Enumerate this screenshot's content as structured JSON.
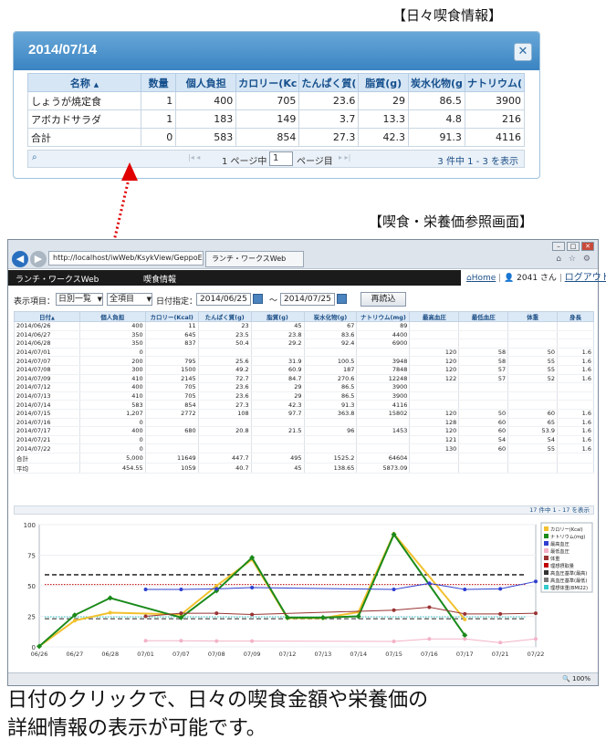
{
  "popup_caption": "【日々喫食情報】",
  "popup": {
    "title": "2014/07/14",
    "close_icon": "close-icon",
    "columns": [
      "名称",
      "数量",
      "個人負担",
      "カロリー(Kc",
      "たんぱく質(",
      "脂質(g)",
      "炭水化物(g",
      "ナトリウム("
    ],
    "sort_mark": "▲",
    "rows": [
      [
        "しょうが焼定食",
        "1",
        "400",
        "705",
        "23.6",
        "29",
        "86.5",
        "3900"
      ],
      [
        "アボカドサラダ",
        "1",
        "183",
        "149",
        "3.7",
        "13.3",
        "4.8",
        "216"
      ],
      [
        "合計",
        "0",
        "583",
        "854",
        "27.3",
        "42.3",
        "91.3",
        "4116"
      ]
    ],
    "pager": {
      "page_label": "1 ページ中",
      "page": "1",
      "page_suffix": "ページ目",
      "count": "3 件中 1 - 3 を表示"
    }
  },
  "main_caption": "【喫食・栄養価参照画面】",
  "browser": {
    "address": "http://localhost/iwWeb/KsykView/GeppoE",
    "tab": "ランチ・ワークスWeb",
    "app_title": "ランチ・ワークスWeb",
    "page_title": "喫食情報",
    "home": "Home",
    "user": "2041 さん",
    "logout": "ログアウト",
    "toolbar": {
      "label1": "表示項目：",
      "mode": "日別一覧",
      "items": "全項目",
      "date_label": "日付指定：",
      "date_from": "2014/06/25",
      "tilde": "～",
      "date_to": "2014/07/25",
      "reload": "再読込"
    },
    "grid_columns": [
      "日付",
      "個人負担",
      "カロリー(Kcal)",
      "たんぱく質(g)",
      "脂質(g)",
      "炭水化物(g)",
      "ナトリウム(mg)",
      "最高血圧",
      "最低血圧",
      "体重",
      "身長"
    ],
    "grid_sort": "▲",
    "grid_rows": [
      [
        "2014/06/26",
        "400",
        "11",
        "23",
        "45",
        "67",
        "89",
        "",
        "",
        "",
        ""
      ],
      [
        "2014/06/27",
        "350",
        "645",
        "23.5",
        "23.8",
        "83.6",
        "4400",
        "",
        "",
        "",
        ""
      ],
      [
        "2014/06/28",
        "350",
        "837",
        "50.4",
        "29.2",
        "92.4",
        "6900",
        "",
        "",
        "",
        ""
      ],
      [
        "2014/07/01",
        "0",
        "",
        "",
        "",
        "",
        "",
        "120",
        "58",
        "50",
        "1.6"
      ],
      [
        "2014/07/07",
        "200",
        "795",
        "25.6",
        "31.9",
        "100.5",
        "3948",
        "120",
        "58",
        "55",
        "1.6"
      ],
      [
        "2014/07/08",
        "300",
        "1500",
        "49.2",
        "60.9",
        "187",
        "7848",
        "120",
        "57",
        "55",
        "1.6"
      ],
      [
        "2014/07/09",
        "410",
        "2145",
        "72.7",
        "84.7",
        "270.6",
        "12248",
        "122",
        "57",
        "52",
        "1.6"
      ],
      [
        "2014/07/12",
        "400",
        "705",
        "23.6",
        "29",
        "86.5",
        "3900",
        "",
        "",
        "",
        ""
      ],
      [
        "2014/07/13",
        "410",
        "705",
        "23.6",
        "29",
        "86.5",
        "3900",
        "",
        "",
        "",
        ""
      ],
      [
        "2014/07/14",
        "583",
        "854",
        "27.3",
        "42.3",
        "91.3",
        "4116",
        "",
        "",
        "",
        ""
      ],
      [
        "2014/07/15",
        "1,207",
        "2772",
        "108",
        "97.7",
        "363.8",
        "15802",
        "120",
        "50",
        "60",
        "1.6"
      ],
      [
        "2014/07/16",
        "0",
        "",
        "",
        "",
        "",
        "",
        "128",
        "60",
        "65",
        "1.6"
      ],
      [
        "2014/07/17",
        "400",
        "680",
        "20.8",
        "21.5",
        "96",
        "1453",
        "120",
        "60",
        "53.9",
        "1.6"
      ],
      [
        "2014/07/21",
        "0",
        "",
        "",
        "",
        "",
        "",
        "121",
        "54",
        "54",
        "1.6"
      ],
      [
        "2014/07/22",
        "0",
        "",
        "",
        "",
        "",
        "",
        "130",
        "60",
        "55",
        "1.6"
      ],
      [
        "合計",
        "5,000",
        "11649",
        "447.7",
        "495",
        "1525.2",
        "64604",
        "",
        "",
        "",
        ""
      ],
      [
        "平均",
        "454.55",
        "1059",
        "40.7",
        "45",
        "138.65",
        "5873.09",
        "",
        "",
        "",
        ""
      ]
    ],
    "grid_pager": "17 件中 1 - 17 を表示",
    "zoom": "100%"
  },
  "chart_data": {
    "type": "line",
    "categories": [
      "06/26",
      "06/27",
      "06/28",
      "07/01",
      "07/07",
      "07/08",
      "07/09",
      "07/12",
      "07/13",
      "07/14",
      "07/15",
      "07/16",
      "07/17",
      "07/21",
      "07/22"
    ],
    "ylim": [
      0,
      100
    ],
    "yticks": [
      "0",
      "25",
      "50",
      "75",
      "100"
    ],
    "legend_placement": "right",
    "series": [
      {
        "name": "カロリー(Kcal)",
        "color": "#f2c12e",
        "values": [
          0.5,
          21.5,
          28,
          null,
          26.5,
          50,
          71.5,
          23.5,
          23.5,
          28.5,
          92.5,
          null,
          22.5,
          null,
          null
        ]
      },
      {
        "name": "ナトリウム(mg)",
        "color": "#1a8a1a",
        "values": [
          0.5,
          26,
          40,
          null,
          24,
          46,
          73,
          24,
          24,
          25,
          92,
          null,
          9.5,
          null,
          null
        ]
      },
      {
        "name": "最高血圧",
        "color": "#2f3fd0",
        "values": [
          null,
          null,
          null,
          47,
          47,
          47.5,
          48.5,
          null,
          null,
          null,
          47,
          52,
          47,
          47.5,
          53.5
        ]
      },
      {
        "name": "最低血圧",
        "color": "#f3b2c8",
        "values": [
          null,
          null,
          null,
          5,
          5,
          4.8,
          4.8,
          null,
          null,
          null,
          4.5,
          6.5,
          6.5,
          3.5,
          6.5
        ]
      },
      {
        "name": "体重",
        "color": "#993333",
        "values": [
          null,
          null,
          null,
          25,
          27.5,
          27.5,
          26.5,
          null,
          null,
          null,
          30,
          32.5,
          27,
          27,
          27.5
        ]
      },
      {
        "name": "理想摂取量",
        "color": "#c00000",
        "values": [
          null,
          null,
          null,
          null,
          null,
          null,
          null,
          null,
          null,
          null,
          null,
          null,
          null,
          null,
          null
        ]
      },
      {
        "name": "高血圧基準(最高)",
        "color": "#333333",
        "values": [
          null,
          null,
          null,
          null,
          null,
          null,
          null,
          null,
          null,
          null,
          null,
          null,
          null,
          null,
          null
        ]
      },
      {
        "name": "高血圧基準(最低)",
        "color": "#777777",
        "values": [
          null,
          null,
          null,
          null,
          null,
          null,
          null,
          null,
          null,
          null,
          null,
          null,
          null,
          null,
          null
        ]
      },
      {
        "name": "理想体重(BMI22)",
        "color": "#33cccc",
        "values": [
          null,
          null,
          null,
          null,
          null,
          null,
          null,
          null,
          null,
          null,
          null,
          null,
          null,
          null,
          null
        ]
      }
    ],
    "reference_lines": [
      {
        "series": "理想摂取量",
        "y": 51,
        "color": "#c00000",
        "style": "dotted"
      },
      {
        "series": "高血圧基準(最高)",
        "y": 59,
        "color": "#333333",
        "style": "dashed"
      },
      {
        "series": "高血圧基準(最低)",
        "y": 23,
        "color": "#777777",
        "style": "dashed"
      },
      {
        "series": "理想体重(BMI22)",
        "y": 24.5,
        "color": "#33cccc",
        "style": "dotted"
      }
    ]
  },
  "bottom_text": [
    "日付のクリックで、日々の喫食金額や栄養価の",
    "詳細情報の表示が可能です。"
  ]
}
